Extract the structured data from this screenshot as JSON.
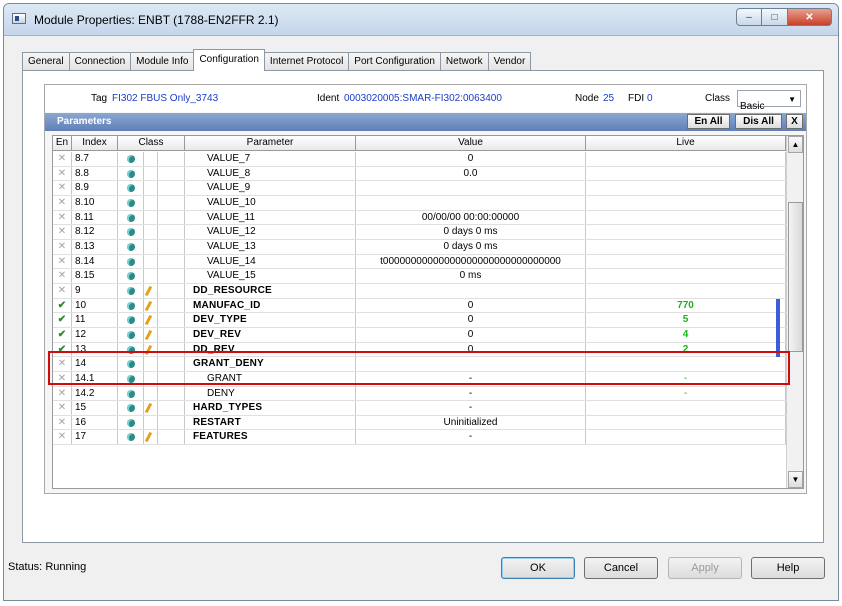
{
  "window": {
    "title": "Module Properties: ENBT (1788-EN2FFR 2.1)"
  },
  "tabs": [
    {
      "label": "General"
    },
    {
      "label": "Connection"
    },
    {
      "label": "Module Info"
    },
    {
      "label": "Configuration",
      "active": true
    },
    {
      "label": "Internet Protocol"
    },
    {
      "label": "Port Configuration"
    },
    {
      "label": "Network"
    },
    {
      "label": "Vendor"
    }
  ],
  "device_header": {
    "tag_label": "Tag",
    "tag_value": "FI302 FBUS Only_3743",
    "ident_label": "Ident",
    "ident_value": "0003020005:SMAR-FI302:0063400",
    "node_label": "Node",
    "node_value": "25",
    "fdi_label": "FDI",
    "fdi_value": "0",
    "class_label": "Class",
    "class_value": "Basic"
  },
  "parameters_bar": {
    "title": "Parameters",
    "enable_all": "En All",
    "disable_all": "Dis All",
    "close": "X"
  },
  "table": {
    "columns": [
      "En",
      "Index",
      "Class",
      "Parameter",
      "Value",
      "Live"
    ],
    "rows": [
      {
        "en": "x",
        "index": "8.7",
        "writable": false,
        "param": "VALUE_7",
        "bold": false,
        "value": "0",
        "live": ""
      },
      {
        "en": "x",
        "index": "8.8",
        "writable": false,
        "param": "VALUE_8",
        "bold": false,
        "value": "0.0",
        "live": ""
      },
      {
        "en": "x",
        "index": "8.9",
        "writable": false,
        "param": "VALUE_9",
        "bold": false,
        "value": "",
        "live": ""
      },
      {
        "en": "x",
        "index": "8.10",
        "writable": false,
        "param": "VALUE_10",
        "bold": false,
        "value": "",
        "live": ""
      },
      {
        "en": "x",
        "index": "8.11",
        "writable": false,
        "param": "VALUE_11",
        "bold": false,
        "value": "00/00/00 00:00:00000",
        "live": ""
      },
      {
        "en": "x",
        "index": "8.12",
        "writable": false,
        "param": "VALUE_12",
        "bold": false,
        "value": "0 days 0 ms",
        "live": ""
      },
      {
        "en": "x",
        "index": "8.13",
        "writable": false,
        "param": "VALUE_13",
        "bold": false,
        "value": "0 days 0 ms",
        "live": ""
      },
      {
        "en": "x",
        "index": "8.14",
        "writable": false,
        "param": "VALUE_14",
        "bold": false,
        "value": "t00000000000000000000000000000000",
        "live": ""
      },
      {
        "en": "x",
        "index": "8.15",
        "writable": false,
        "param": "VALUE_15",
        "bold": false,
        "value": "0 ms",
        "live": ""
      },
      {
        "en": "x",
        "index": "9",
        "writable": true,
        "param": "DD_RESOURCE",
        "bold": true,
        "value": "",
        "live": ""
      },
      {
        "en": "check",
        "index": "10",
        "writable": true,
        "param": "MANUFAC_ID",
        "bold": true,
        "value": "0",
        "live": "770"
      },
      {
        "en": "check",
        "index": "11",
        "writable": true,
        "param": "DEV_TYPE",
        "bold": true,
        "value": "0",
        "live": "5"
      },
      {
        "en": "check",
        "index": "12",
        "writable": true,
        "param": "DEV_REV",
        "bold": true,
        "value": "0",
        "live": "4"
      },
      {
        "en": "check",
        "index": "13",
        "writable": true,
        "param": "DD_REV",
        "bold": true,
        "value": "0",
        "live": "2"
      },
      {
        "en": "x",
        "index": "14",
        "writable": false,
        "param": "GRANT_DENY",
        "bold": true,
        "value": "",
        "live": ""
      },
      {
        "en": "x",
        "index": "14.1",
        "writable": false,
        "param": "GRANT",
        "bold": false,
        "value": "-",
        "live": "-"
      },
      {
        "en": "x",
        "index": "14.2",
        "writable": false,
        "param": "DENY",
        "bold": false,
        "value": "-",
        "live": "-"
      },
      {
        "en": "x",
        "index": "15",
        "writable": true,
        "param": "HARD_TYPES",
        "bold": true,
        "value": "-",
        "live": ""
      },
      {
        "en": "x",
        "index": "16",
        "writable": false,
        "param": "RESTART",
        "bold": true,
        "value": "Uninitialized",
        "live": ""
      },
      {
        "en": "x",
        "index": "17",
        "writable": true,
        "param": "FEATURES",
        "bold": true,
        "value": "-",
        "live": ""
      }
    ]
  },
  "status": {
    "label": "Status:",
    "value": "Running"
  },
  "buttons": {
    "ok": "OK",
    "cancel": "Cancel",
    "apply": "Apply",
    "help": "Help"
  },
  "icons": {
    "enabled": "check-icon",
    "disabled": "x-icon",
    "class": "class-dot-icon",
    "writable": "pencil-icon"
  },
  "colors": {
    "live_value": "#19b319",
    "link_blue": "#1b3cc9",
    "highlight_box": "#d10a0a",
    "params_bar": "#5f80b7"
  }
}
